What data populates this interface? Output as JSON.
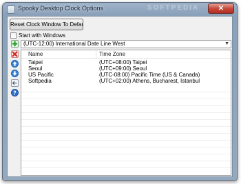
{
  "window": {
    "title": "Spooky Desktop Clock Options",
    "close_glyph": "✕",
    "watermark": "SOFTPEDIA"
  },
  "toolbar": {
    "reset_label": "Reset Clock Window To Defaults",
    "start_with_windows_label": "Start with Windows",
    "start_with_windows_checked": false
  },
  "timezone_select": {
    "value": "(UTC-12:00) International Date Line West"
  },
  "side_buttons": [
    {
      "name": "add",
      "icon": "plus-icon",
      "color": "#2fa32f"
    },
    {
      "name": "delete",
      "icon": "x-icon",
      "color": "#d3281f"
    },
    {
      "name": "move-up",
      "icon": "arrow-up-icon",
      "color": "#2f7fd1"
    },
    {
      "name": "move-down",
      "icon": "arrow-down-icon",
      "color": "#2f7fd1"
    },
    {
      "name": "edit",
      "icon": "edit-icon",
      "color": "#6b7d90"
    },
    {
      "name": "help",
      "icon": "help-icon",
      "color": "#2f6fc8"
    }
  ],
  "clock_list": {
    "columns": [
      "Name",
      "Time Zone"
    ],
    "rows": [
      {
        "name": "Taipei",
        "timezone": "(UTC+08:00) Taipei"
      },
      {
        "name": "Seoul",
        "timezone": "(UTC+09:00) Seoul"
      },
      {
        "name": "US Pacific",
        "timezone": "(UTC-08:00) Pacific Time (US & Canada)"
      },
      {
        "name": "Softpedia",
        "timezone": "(UTC+02:00) Athens, Bucharest, Istanbul"
      }
    ]
  }
}
